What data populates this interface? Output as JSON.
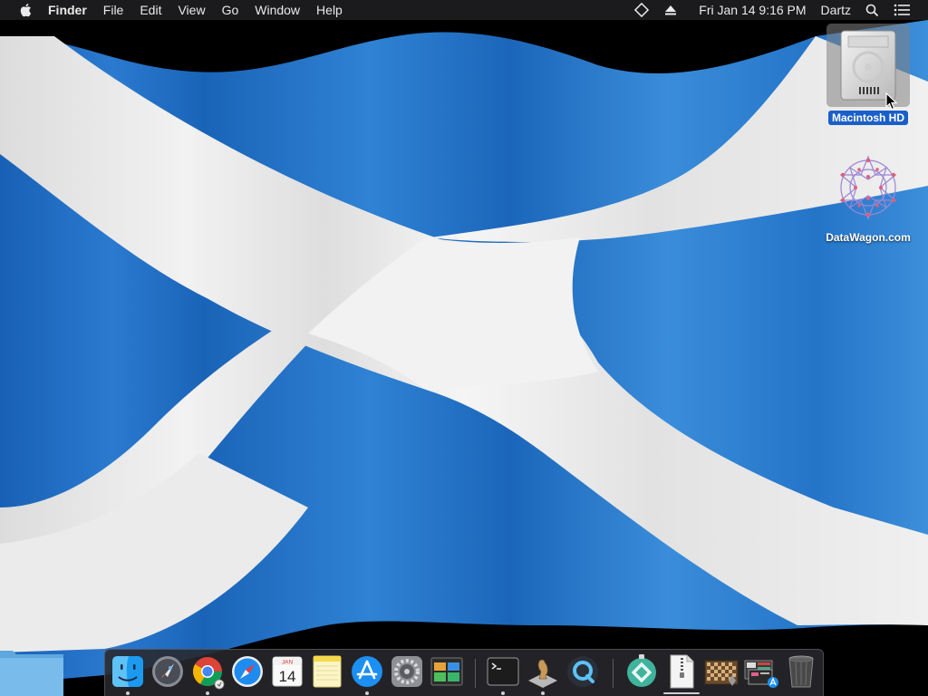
{
  "menubar": {
    "app_name": "Finder",
    "menus": [
      "File",
      "Edit",
      "View",
      "Go",
      "Window",
      "Help"
    ],
    "clock": "Fri Jan 14  9:16 PM",
    "user": "Dartz",
    "icons": [
      "apple-icon",
      "diamond-status-icon",
      "eject-icon",
      "spotlight-search-icon",
      "notification-center-icon"
    ]
  },
  "desktop": {
    "icons": [
      {
        "label": "Macintosh HD",
        "selected": true,
        "icon": "hard-drive-icon"
      },
      {
        "label": "DataWagon.com",
        "selected": false,
        "icon": "datawagon-logo-icon"
      }
    ]
  },
  "dock": {
    "apps": [
      {
        "name": "Finder",
        "icon": "finder-icon",
        "running": true
      },
      {
        "name": "Launchpad",
        "icon": "launchpad-icon",
        "running": false
      },
      {
        "name": "Google Chrome",
        "icon": "chrome-icon",
        "running": true
      },
      {
        "name": "Safari",
        "icon": "safari-icon",
        "running": false
      },
      {
        "name": "Calendar",
        "icon": "calendar-icon",
        "running": false,
        "month": "JAN",
        "day": "14"
      },
      {
        "name": "Notes",
        "icon": "notes-icon",
        "running": false
      },
      {
        "name": "App Store",
        "icon": "app-store-icon",
        "running": true
      },
      {
        "name": "System Preferences",
        "icon": "system-preferences-icon",
        "running": false
      },
      {
        "name": "Photo Booth",
        "icon": "photo-app-icon",
        "running": false
      },
      {
        "name": "Terminal",
        "icon": "terminal-icon",
        "running": true
      },
      {
        "name": "Chess",
        "icon": "chess-icon",
        "running": true
      },
      {
        "name": "QuickTime Player",
        "icon": "quicktime-icon",
        "running": false
      },
      {
        "name": "Downloads",
        "icon": "downloads-stack-icon",
        "running": false
      },
      {
        "name": "Archive",
        "icon": "zip-file-icon",
        "running": false
      },
      {
        "name": "Chess Stack",
        "icon": "chess-board-stack-icon",
        "running": false
      },
      {
        "name": "Screenshots",
        "icon": "screenshots-stack-icon",
        "running": false
      },
      {
        "name": "Trash",
        "icon": "trash-icon",
        "running": false
      }
    ]
  },
  "colors": {
    "flag_blue": "#1f6fc4",
    "flag_blue_light": "#3d8ed8",
    "saltire_white": "#ececec",
    "menubar": "#1b1b1d",
    "selection": "#1a5fc9"
  }
}
